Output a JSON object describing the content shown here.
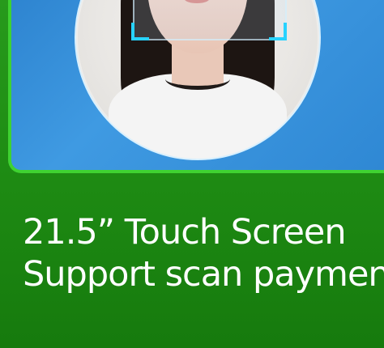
{
  "banner": {
    "headline_line1": "21.5” Touch Screen",
    "headline_line2": "Support scan paymen",
    "colors": {
      "background_green": "#1e8a14",
      "panel_border_green": "#3fd231",
      "panel_blue": "#3f9ae2",
      "scan_cyan": "#27d2ff",
      "text": "#ffffff"
    },
    "image": {
      "subject": "face-recognition-portrait"
    }
  }
}
